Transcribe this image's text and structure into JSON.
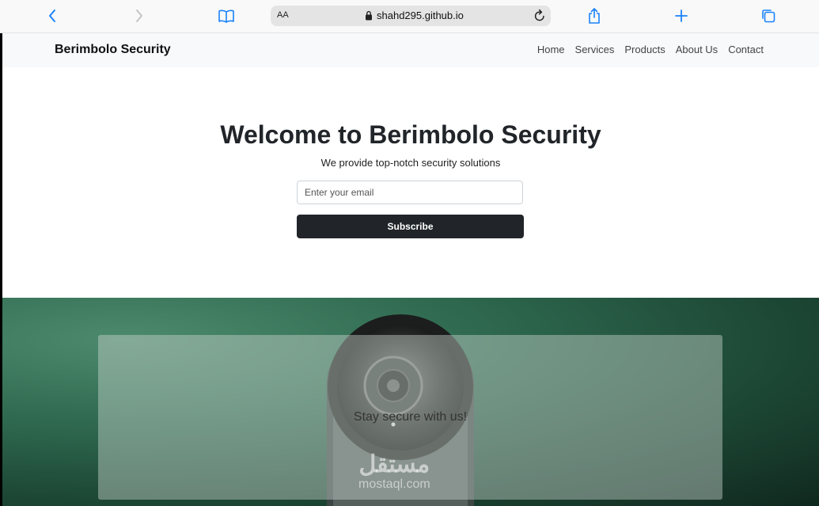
{
  "browser": {
    "url": "shahd295.github.io",
    "reader_label": "AA",
    "icons": [
      "back-icon",
      "forward-icon",
      "bookmarks-icon",
      "lock-icon",
      "reload-icon",
      "share-icon",
      "new-tab-icon",
      "tabs-icon"
    ]
  },
  "navbar": {
    "brand": "Berimbolo Security",
    "links": [
      "Home",
      "Services",
      "Products",
      "About Us",
      "Contact"
    ]
  },
  "hero": {
    "title": "Welcome to Berimbolo Security",
    "subtitle": "We provide top-notch security solutions",
    "email_placeholder": "Enter your email",
    "subscribe_label": "Subscribe"
  },
  "banner": {
    "tagline": "Stay secure with us!"
  },
  "watermark": {
    "arabic": "مستقل",
    "latin": "mostaql.com"
  },
  "colors": {
    "accent": "#1a82fb",
    "button_dark": "#212529",
    "banner_green": "#2f6a50"
  }
}
